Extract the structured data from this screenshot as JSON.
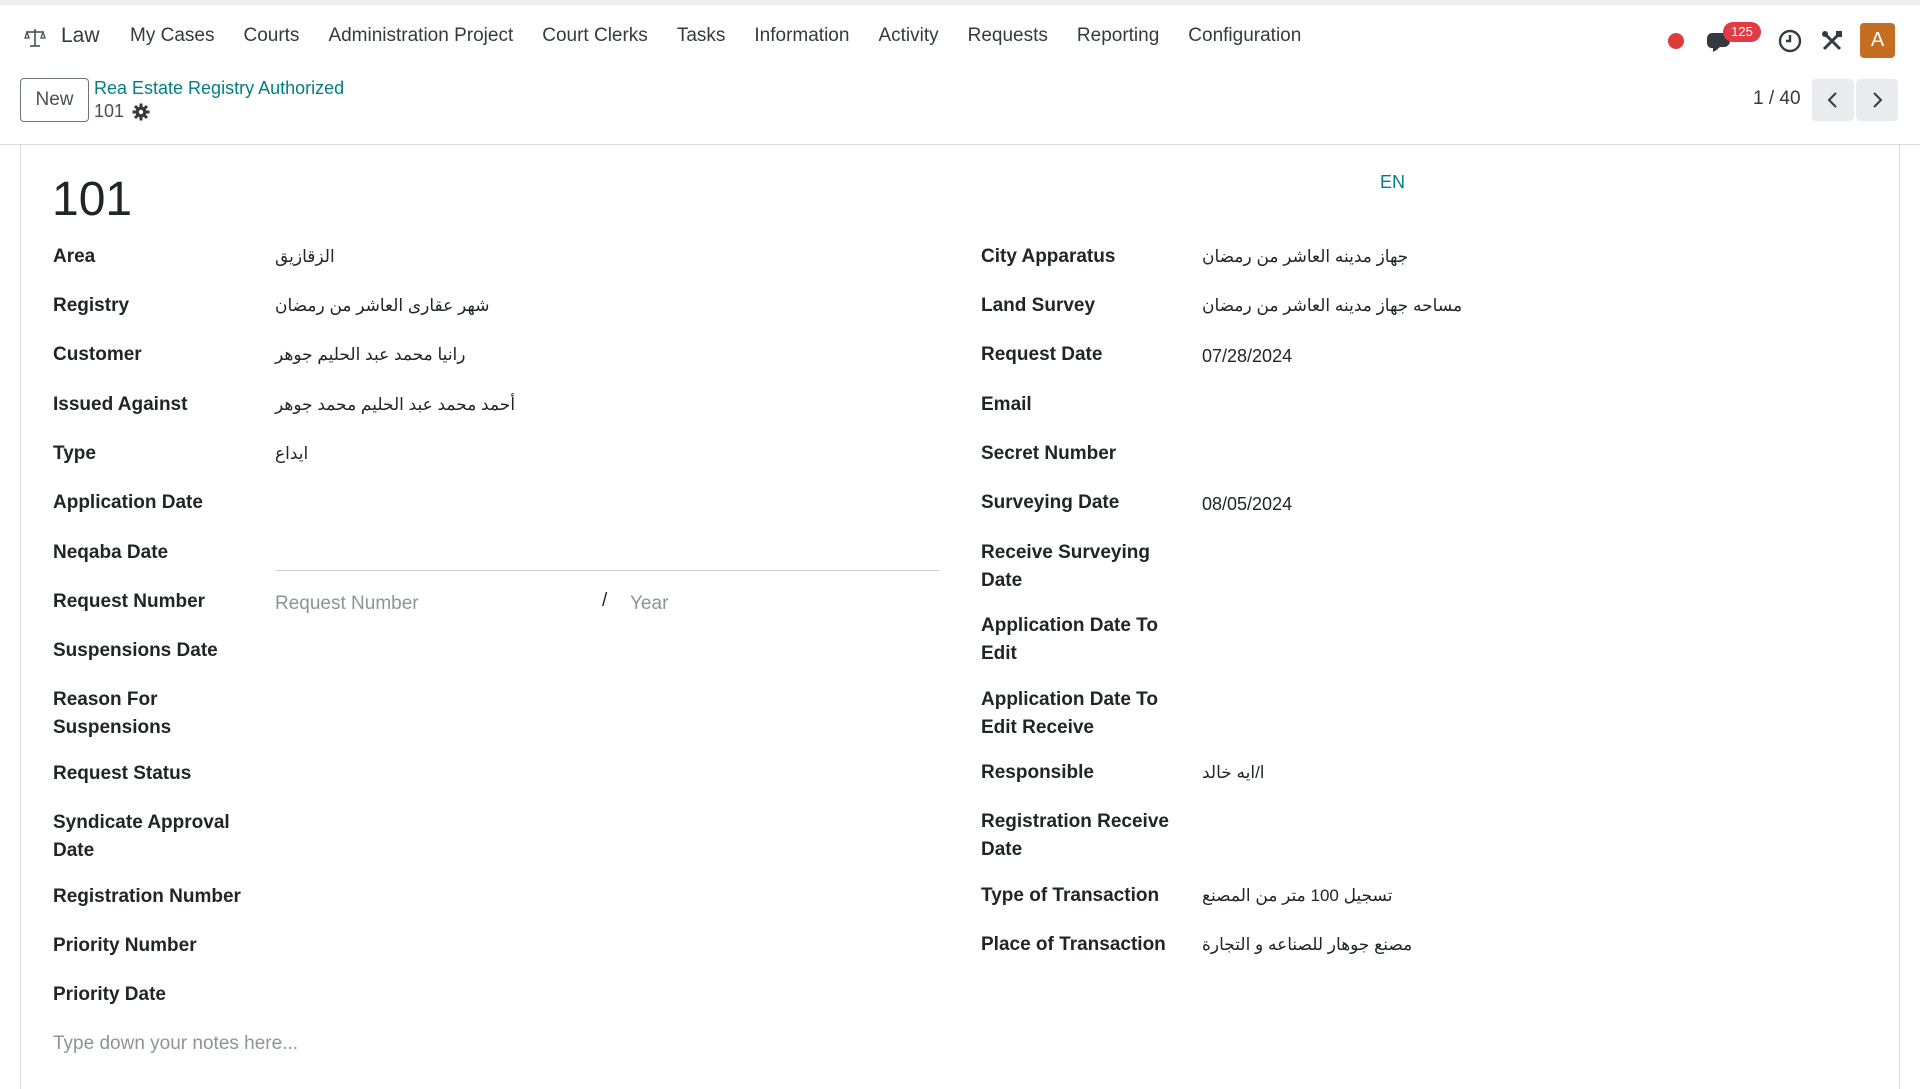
{
  "nav": {
    "brand": "Law",
    "menu": [
      "My Cases",
      "Courts",
      "Administration Project",
      "Court Clerks",
      "Tasks",
      "Information",
      "Activity",
      "Requests",
      "Reporting",
      "Configuration"
    ],
    "messages_badge": "125",
    "avatar_letter": "A",
    "colors": {
      "avatar": "#c46e23",
      "badge": "#e13b45",
      "status_dot": "#e03a3a"
    }
  },
  "control": {
    "new_label": "New",
    "breadcrumb": "Rea Estate Registry Authorized",
    "record_id": "101",
    "pager": "1 / 40"
  },
  "form": {
    "title": "101",
    "lang": "EN",
    "left": [
      {
        "label": "Area",
        "value": "الزقازيق"
      },
      {
        "label": "Registry",
        "value": "شهر عقارى العاشر من رمضان"
      },
      {
        "label": "Customer",
        "value": "رانيا محمد عبد الحليم جوهر"
      },
      {
        "label": "Issued Against",
        "value": "أحمد محمد عبد الحليم محمد جوهر"
      },
      {
        "label": "Type",
        "value": "ايداع"
      },
      {
        "label": "Application Date",
        "value": ""
      },
      {
        "label": "Neqaba Date",
        "value": ""
      },
      {
        "label": "Request Number",
        "value": ""
      },
      {
        "label": "Suspensions Date",
        "value": ""
      },
      {
        "label": "Reason For Suspensions",
        "value": ""
      },
      {
        "label": "Request Status",
        "value": ""
      },
      {
        "label": "Syndicate Approval Date",
        "value": ""
      },
      {
        "label": "Registration Number",
        "value": ""
      },
      {
        "label": "Priority Number",
        "value": ""
      },
      {
        "label": "Priority Date",
        "value": ""
      }
    ],
    "right": [
      {
        "label": "City Apparatus",
        "value": "جهاز مدينه العاشر من رمضان"
      },
      {
        "label": "Land Survey",
        "value": "مساحه جهاز مدينه العاشر من رمضان"
      },
      {
        "label": "Request Date",
        "value": "07/28/2024"
      },
      {
        "label": "Email",
        "value": ""
      },
      {
        "label": "Secret Number",
        "value": ""
      },
      {
        "label": "Surveying Date",
        "value": "08/05/2024"
      },
      {
        "label": "Receive Surveying Date",
        "value": ""
      },
      {
        "label": "Application Date To Edit",
        "value": ""
      },
      {
        "label": "Application Date To Edit Receive",
        "value": ""
      },
      {
        "label": "Responsible",
        "value": "ا/ايه خالد"
      },
      {
        "label": "Registration Receive Date",
        "value": ""
      },
      {
        "label": "Type of Transaction",
        "value": "تسجيل 100 متر من المصنع"
      },
      {
        "label": "Place of Transaction",
        "value": "مصنع جوهار للصناعه و التجارة"
      }
    ],
    "request_number_placeholder": "Request Number",
    "request_slash": "/",
    "year_placeholder": "Year",
    "notes_placeholder": "Type down your notes here..."
  }
}
